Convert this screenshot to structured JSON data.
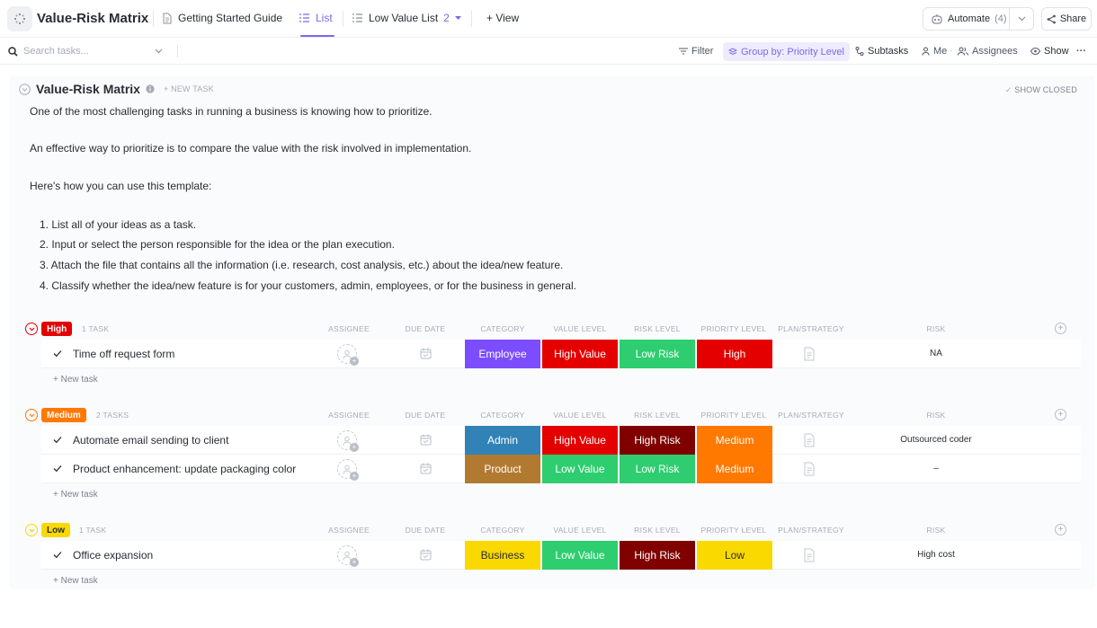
{
  "topbar": {
    "title": "Value-Risk Matrix",
    "nav": [
      {
        "label": "Getting Started Guide"
      },
      {
        "label": "List"
      },
      {
        "label": "Low Value List",
        "badge": "2"
      },
      {
        "label": "+ View"
      }
    ],
    "automate_label": "Automate",
    "automate_count": "(4)",
    "share_label": "Share"
  },
  "toolbar": {
    "search_placeholder": "Search tasks...",
    "filter": "Filter",
    "group_by": "Group by: Priority Level",
    "subtasks": "Subtasks",
    "me": "Me",
    "dot": "·",
    "assignees": "Assignees",
    "show": "Show",
    "more": "···"
  },
  "list": {
    "title": "Value-Risk Matrix",
    "new_task": "+ NEW TASK",
    "show_closed": "SHOW CLOSED",
    "description": [
      "One of the most challenging tasks in running a business is knowing how to prioritize.",
      "An effective way to prioritize is to compare the value with the risk involved in implementation.",
      "Here's how you can use this template:"
    ],
    "steps": [
      "1.  List all of your ideas as a task.",
      "2.  Input or select the person responsible for the idea or the plan execution.",
      "3.  Attach the file that contains all the information (i.e. research, cost analysis, etc.) about the idea/new feature.",
      "4.  Classify whether the idea/new feature is for your customers, admin, employees, or for the business in general."
    ]
  },
  "columns": [
    "ASSIGNEE",
    "DUE DATE",
    "CATEGORY",
    "VALUE LEVEL",
    "RISK LEVEL",
    "PRIORITY LEVEL",
    "PLAN/STRATEGY",
    "RISK"
  ],
  "new_task_row": "+ New task",
  "groups": [
    {
      "label": "High",
      "count": "1 TASK",
      "color": "#e50000",
      "text_color": "#ffffff",
      "tasks": [
        {
          "name": "Time off request form",
          "category": {
            "label": "Employee",
            "color": "#7c4dff"
          },
          "value": {
            "label": "High Value",
            "color": "#e50000"
          },
          "risk_level": {
            "label": "Low Risk",
            "color": "#2ecd6f"
          },
          "priority": {
            "label": "High",
            "color": "#e50000"
          },
          "risk": "NA"
        }
      ]
    },
    {
      "label": "Medium",
      "count": "2 TASKS",
      "color": "#ff7800",
      "text_color": "#ffffff",
      "tasks": [
        {
          "name": "Automate email sending to client",
          "category": {
            "label": "Admin",
            "color": "#3082b7"
          },
          "value": {
            "label": "High Value",
            "color": "#e50000"
          },
          "risk_level": {
            "label": "High Risk",
            "color": "#800000"
          },
          "priority": {
            "label": "Medium",
            "color": "#ff7800"
          },
          "risk": "Outsourced coder"
        },
        {
          "name": "Product enhancement: update packaging color",
          "category": {
            "label": "Product",
            "color": "#b27a30"
          },
          "value": {
            "label": "Low Value",
            "color": "#2ecd6f"
          },
          "risk_level": {
            "label": "Low Risk",
            "color": "#2ecd6f"
          },
          "priority": {
            "label": "Medium",
            "color": "#ff7800"
          },
          "risk": "–"
        }
      ]
    },
    {
      "label": "Low",
      "count": "1 TASK",
      "color": "#f9d900",
      "text_color": "#292d34",
      "tasks": [
        {
          "name": "Office expansion",
          "category": {
            "label": "Business",
            "color": "#f9d900",
            "text_color": "#292d34"
          },
          "value": {
            "label": "Low Value",
            "color": "#2ecd6f"
          },
          "risk_level": {
            "label": "High Risk",
            "color": "#800000"
          },
          "priority": {
            "label": "Low",
            "color": "#f9d900",
            "text_color": "#292d34"
          },
          "risk": "High cost"
        }
      ]
    }
  ],
  "icons": {
    "app": "loader-dots-icon",
    "doc": "document-icon",
    "list": "list-icon",
    "automate": "robot-icon",
    "share": "share-icon",
    "search": "search-icon",
    "filter": "filter-icon",
    "group": "layers-icon",
    "subtasks": "subtasks-icon",
    "person": "person-icon",
    "people": "people-icon",
    "eye": "eye-icon",
    "calendar": "calendar-icon",
    "file": "file-icon",
    "check": "check-icon",
    "info": "info-icon"
  }
}
